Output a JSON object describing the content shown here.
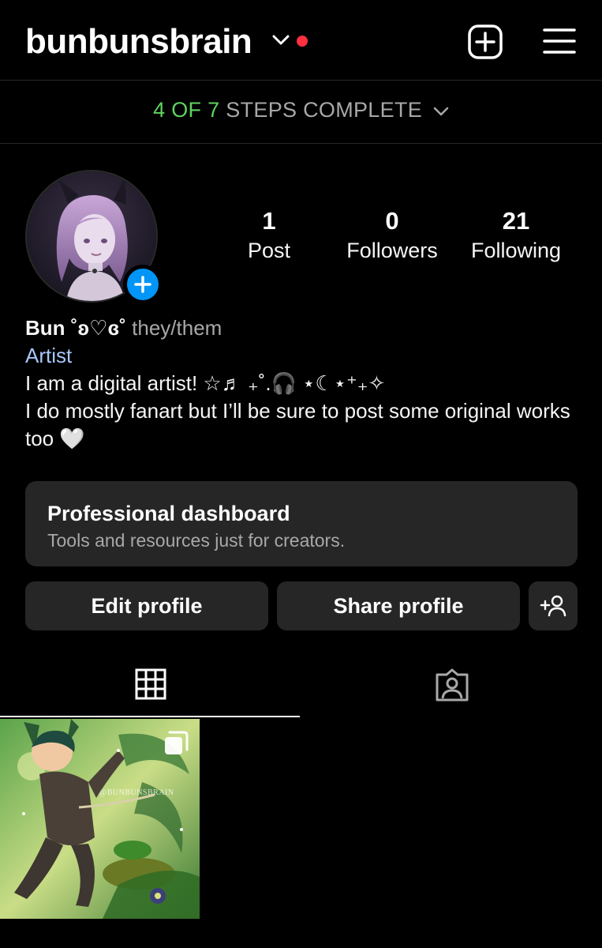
{
  "header": {
    "username": "bunbunsbrain",
    "accent_notification": "#ff3040"
  },
  "steps": {
    "progress_text": "4 OF 7",
    "label": "STEPS COMPLETE"
  },
  "profile": {
    "stats": [
      {
        "value": "1",
        "label": "Post"
      },
      {
        "value": "0",
        "label": "Followers"
      },
      {
        "value": "21",
        "label": "Following"
      }
    ],
    "name": "Bun ˚ʚ♡ɞ˚",
    "pronouns": "they/them",
    "category": "Artist",
    "bio_lines": [
      "I am a digital artist! ☆♬ ₊˚.🎧 ⋆☾⋆⁺₊✧",
      "I do mostly fanart but I’ll be sure to post some original works too 🤍"
    ]
  },
  "dashboard": {
    "title": "Professional dashboard",
    "subtitle": "Tools and resources just for creators."
  },
  "actions": {
    "edit_label": "Edit profile",
    "share_label": "Share profile"
  },
  "tabs": {
    "active": "grid-icon",
    "items": [
      "grid-icon",
      "tagged-icon"
    ]
  },
  "posts": [
    {
      "watermark": "@BUNBUNSBRAIN",
      "multi_image": true
    }
  ],
  "colors": {
    "background": "#000000",
    "surface": "#262626",
    "progress_green": "#5fd35f",
    "link_blue": "#a8c7fa",
    "badge_blue": "#0095f6"
  }
}
